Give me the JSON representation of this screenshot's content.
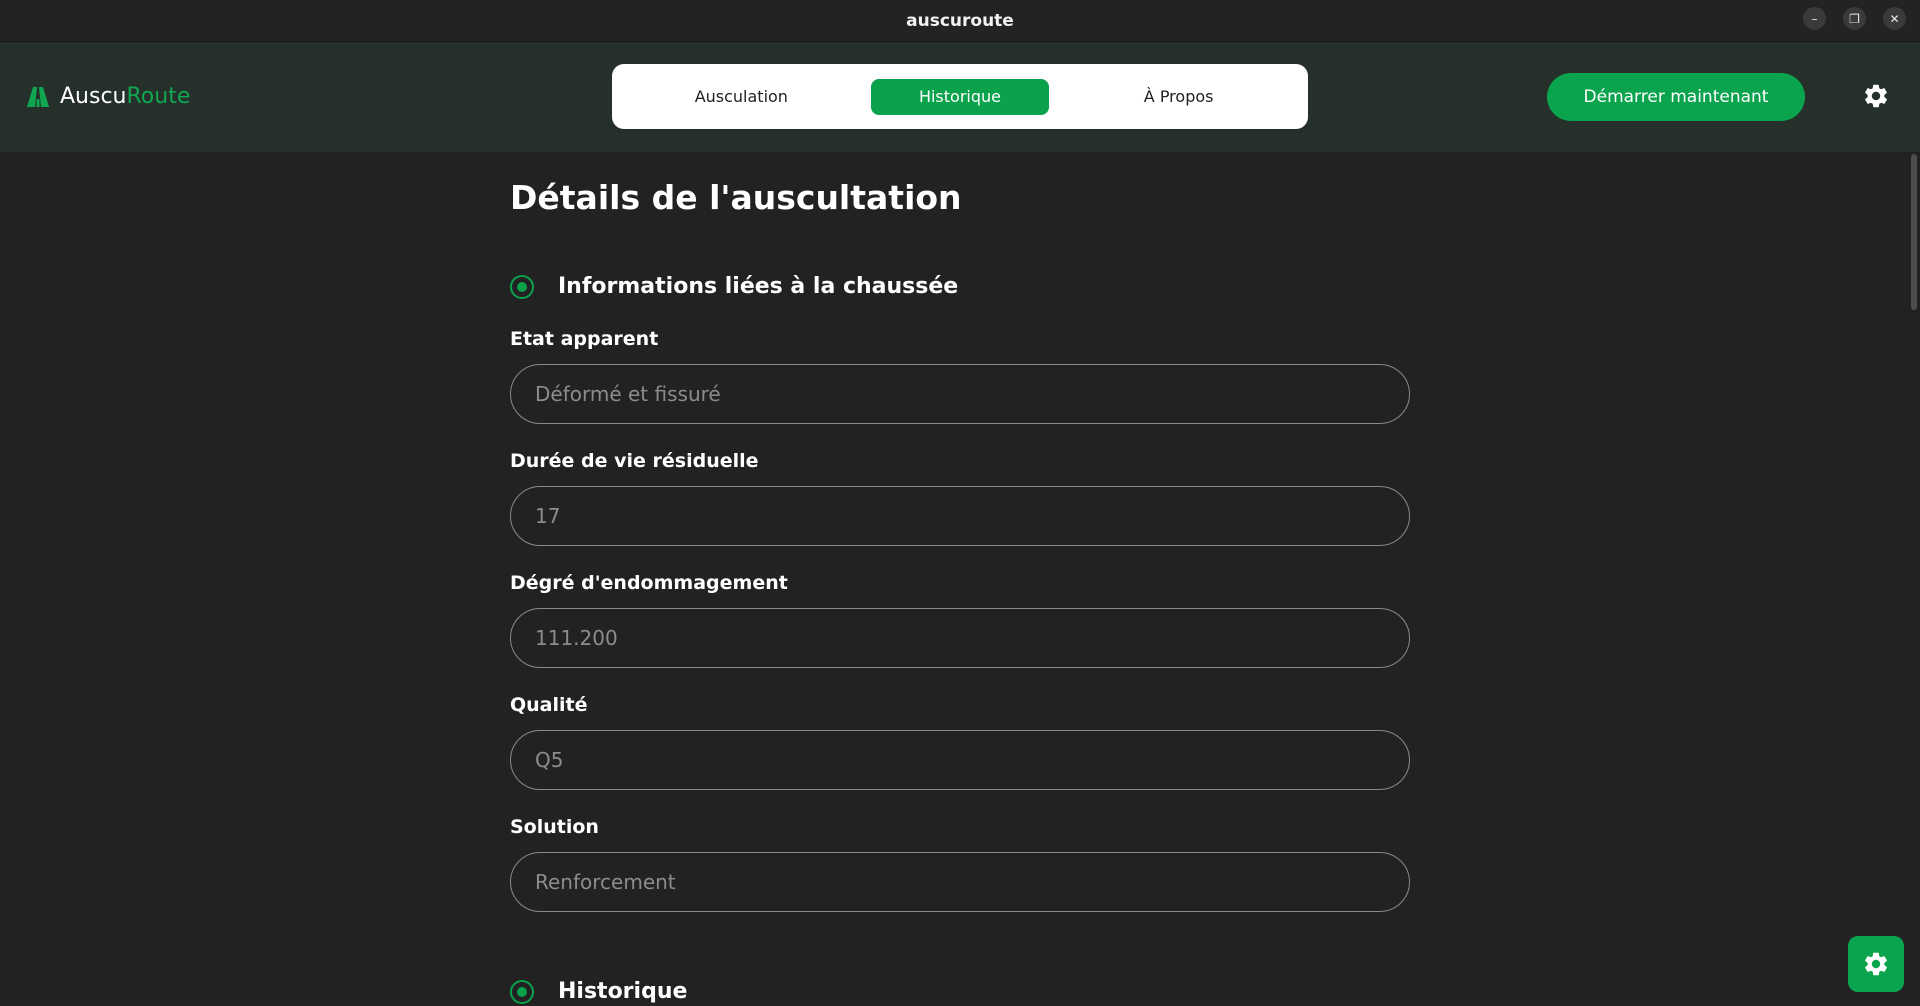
{
  "window": {
    "title": "auscuroute",
    "controls": {
      "minimize": "–",
      "restore": "❐",
      "close": "✕"
    }
  },
  "brand": {
    "name_part1": "Auscu",
    "name_part2": "Route",
    "accent_color": "#10a651"
  },
  "nav": {
    "tabs": [
      {
        "label": "Ausculation",
        "active": false
      },
      {
        "label": "Historique",
        "active": true
      },
      {
        "label": "À Propos",
        "active": false
      }
    ]
  },
  "cta": {
    "label": "Démarrer maintenant"
  },
  "icons": {
    "settings": "gear-icon",
    "logo": "road-icon"
  },
  "page": {
    "title": "Détails de l'auscultation",
    "sections": [
      {
        "title": "Informations liées à la chaussée"
      },
      {
        "title": "Historique"
      }
    ],
    "fields": [
      {
        "label": "Etat apparent",
        "placeholder": "Déformé et fissuré"
      },
      {
        "label": "Durée de vie résiduelle",
        "placeholder": "17"
      },
      {
        "label": "Dégré d'endommagement",
        "placeholder": "111.200"
      },
      {
        "label": "Qualité",
        "placeholder": "Q5"
      },
      {
        "label": "Solution",
        "placeholder": "Renforcement"
      }
    ]
  },
  "colors": {
    "background": "#222222",
    "header": "#26302a",
    "primary": "#0ba24c"
  }
}
